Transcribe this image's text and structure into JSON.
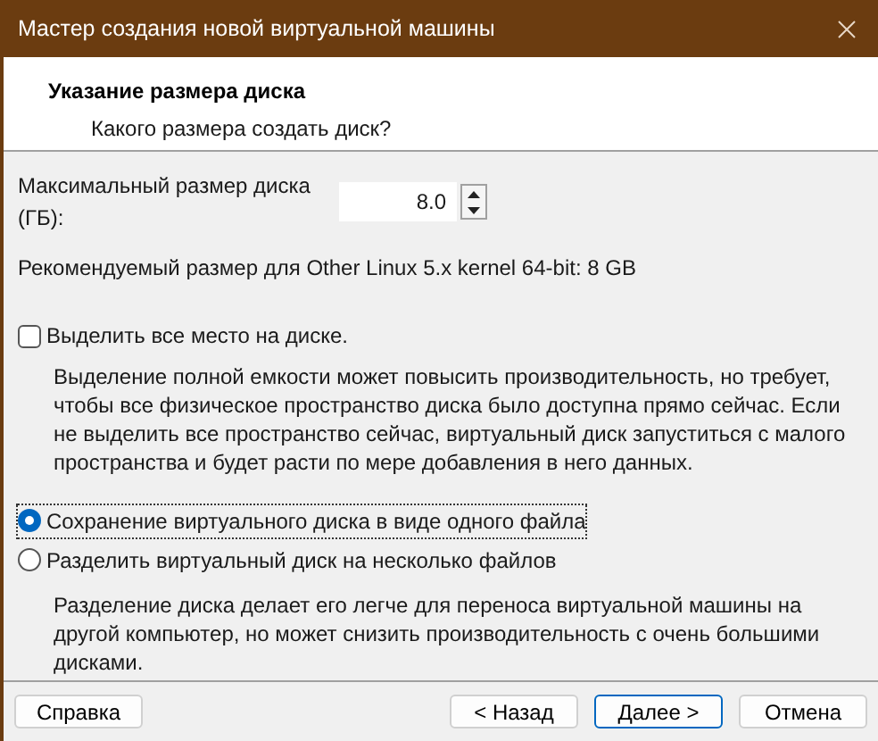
{
  "window": {
    "title": "Мастер создания новой виртуальной машины"
  },
  "header": {
    "title": "Указание размера диска",
    "subtitle": "Какого размера создать диск?"
  },
  "size": {
    "label": "Максимальный размер диска (ГБ):",
    "value": "8.0"
  },
  "recommended": "Рекомендуемый размер для Other Linux 5.x kernel 64-bit: 8 GB",
  "allocate": {
    "label": "Выделить все место на диске.",
    "checked": false,
    "description": "Выделение полной емкости может повысить производительность, но требует, чтобы все физическое пространство диска было доступна прямо сейчас. Если не выделить все пространство сейчас, виртуальный диск запуститься с малого пространства и будет расти по мере добавления в него данных."
  },
  "storage_options": [
    {
      "label": "Сохранение виртуального диска в виде одного файла",
      "selected": true
    },
    {
      "label": "Разделить виртуальный диск на несколько файлов",
      "selected": false,
      "description": "Разделение диска делает его легче для переноса виртуальной машины на другой компьютер, но может снизить производительность с очень большими дисками."
    }
  ],
  "buttons": [
    {
      "label": "Справка",
      "default": false
    },
    {
      "label": "< Назад",
      "default": false
    },
    {
      "label": "Далее >",
      "default": true
    },
    {
      "label": "Отмена",
      "default": false
    }
  ]
}
